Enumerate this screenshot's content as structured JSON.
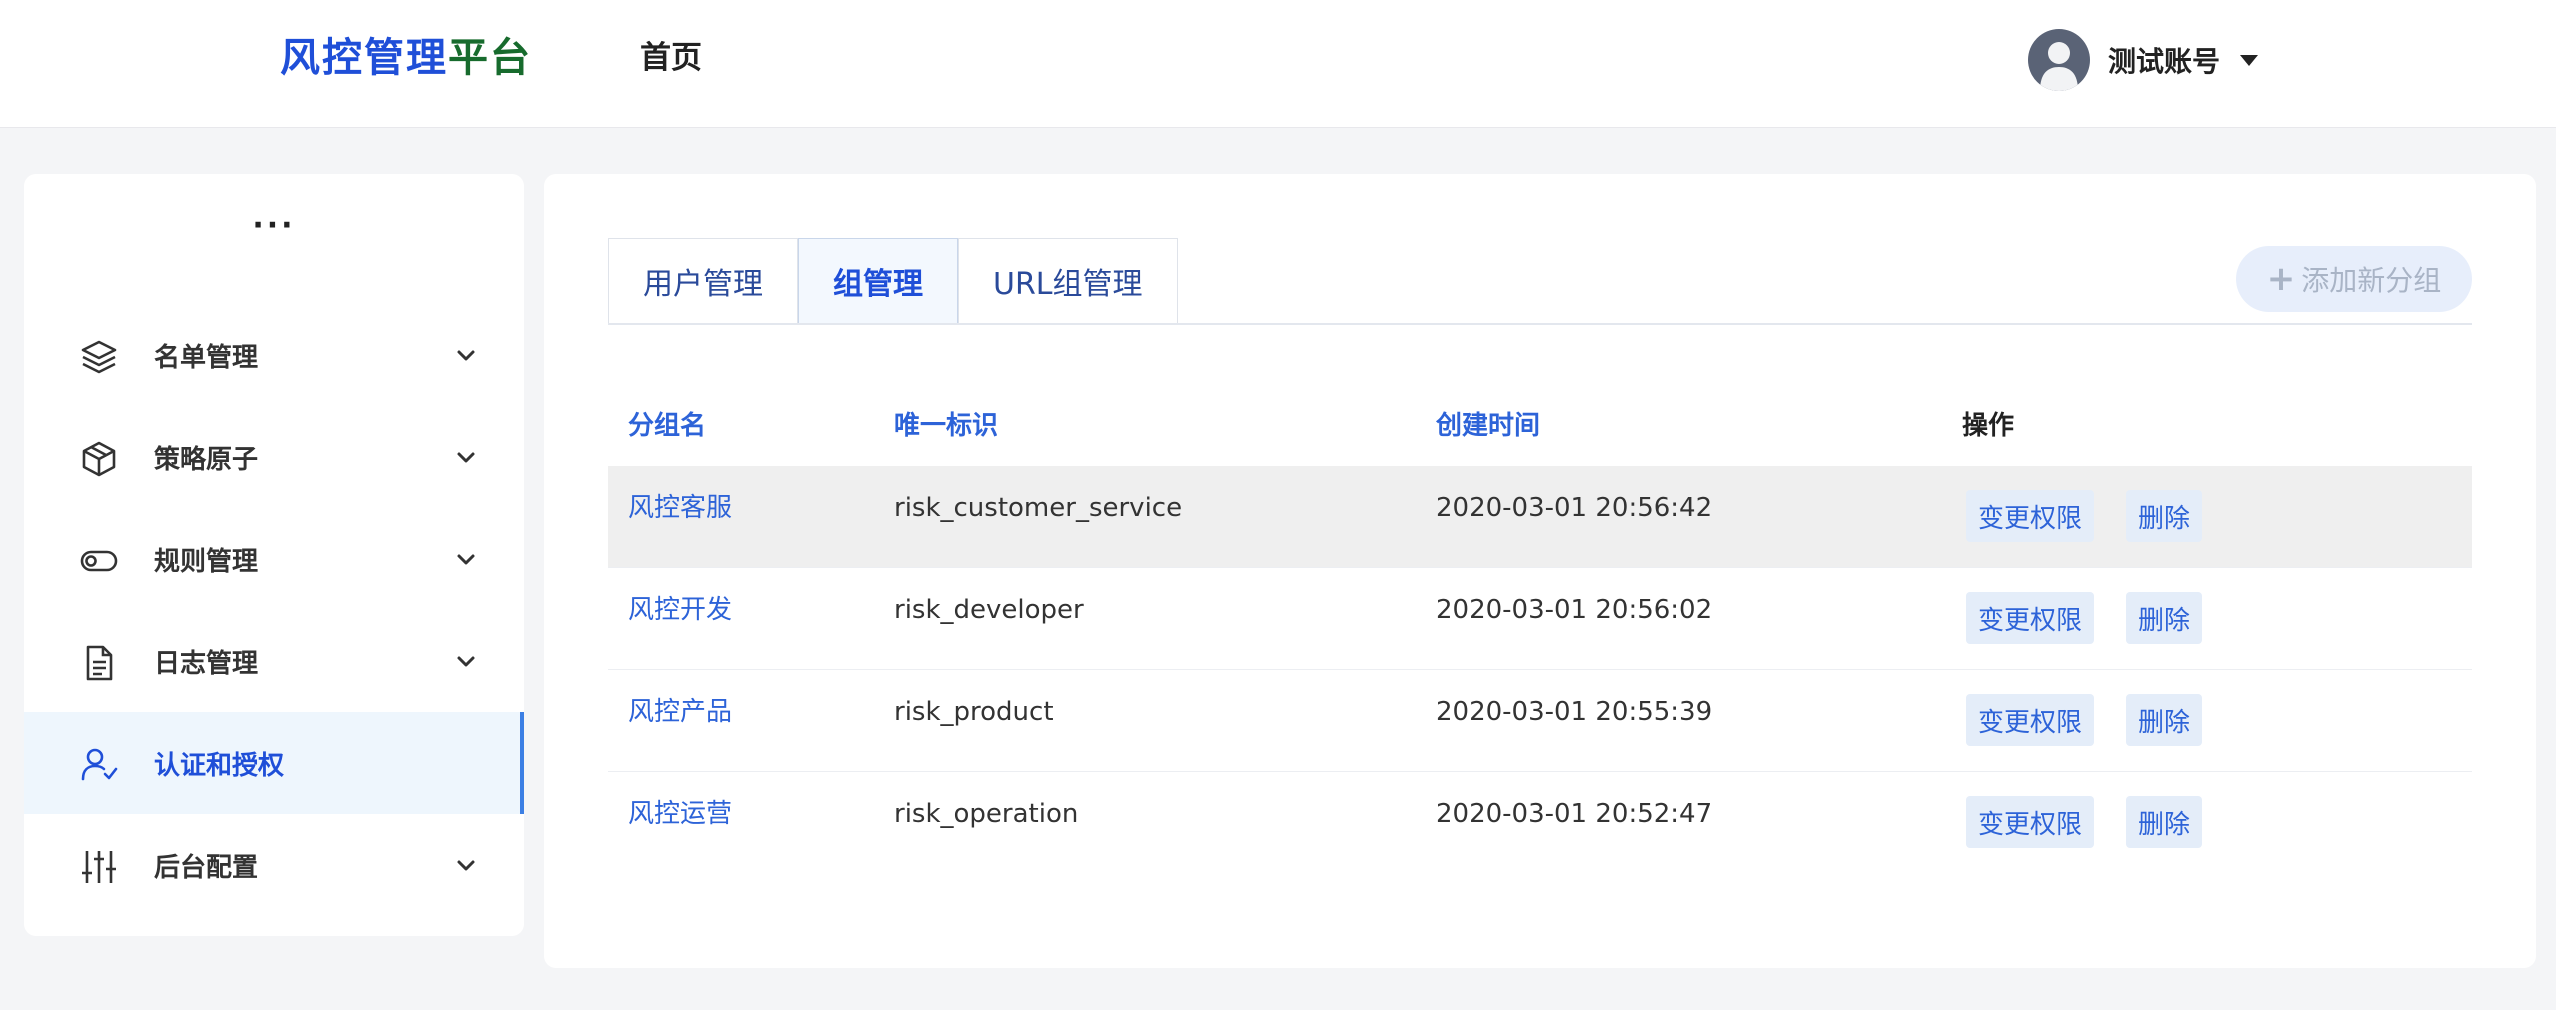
{
  "header": {
    "logo_part1": "风控管理",
    "logo_part2": "平台",
    "nav_home": "首页",
    "user_name": "测试账号"
  },
  "sidebar": {
    "more": "···",
    "items": [
      {
        "label": "名单管理",
        "icon": "layers-icon",
        "expandable": true
      },
      {
        "label": "策略原子",
        "icon": "package-icon",
        "expandable": true
      },
      {
        "label": "规则管理",
        "icon": "toggle-icon",
        "expandable": true
      },
      {
        "label": "日志管理",
        "icon": "document-icon",
        "expandable": true
      },
      {
        "label": "认证和授权",
        "icon": "user-check-icon",
        "expandable": false,
        "active": true
      },
      {
        "label": "后台配置",
        "icon": "sliders-icon",
        "expandable": true
      }
    ]
  },
  "tabs": [
    {
      "label": "用户管理"
    },
    {
      "label": "组管理",
      "active": true
    },
    {
      "label": "URL组管理"
    }
  ],
  "add_button": {
    "label": "添加新分组",
    "icon": "plus-icon"
  },
  "table": {
    "headers": [
      "分组名",
      "唯一标识",
      "创建时间",
      "操作"
    ],
    "rows": [
      {
        "name": "风控客服",
        "id": "risk_customer_service",
        "created": "2020-03-01 20:56:42"
      },
      {
        "name": "风控开发",
        "id": "risk_developer",
        "created": "2020-03-01 20:56:02"
      },
      {
        "name": "风控产品",
        "id": "risk_product",
        "created": "2020-03-01 20:55:39"
      },
      {
        "name": "风控运营",
        "id": "risk_operation",
        "created": "2020-03-01 20:52:47"
      }
    ],
    "action_edit": "变更权限",
    "action_delete": "删除"
  },
  "colors": {
    "accent": "#1f4fd8",
    "logo_green": "#176b2d",
    "active_bg": "#eef6fd",
    "button_bg": "#e4edf9",
    "row_highlight": "#efefef"
  }
}
